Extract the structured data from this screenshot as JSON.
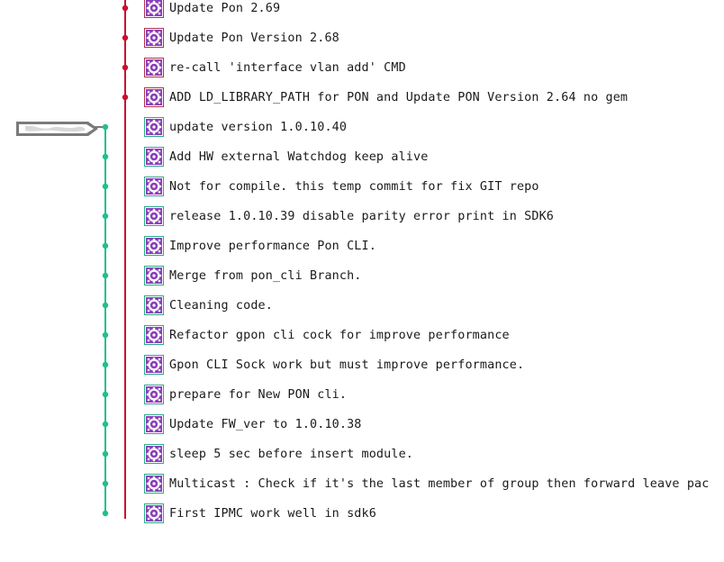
{
  "branches": {
    "main_color": "#c8102e",
    "feature_color": "#1fbf8f"
  },
  "commits": [
    {
      "message": "Update Pon 2.69",
      "branch": "main"
    },
    {
      "message": "Update Pon Version 2.68",
      "branch": "main"
    },
    {
      "message": "re-call 'interface vlan add' CMD",
      "branch": "main"
    },
    {
      "message": "ADD LD_LIBRARY_PATH for PON and Update PON Version 2.64 no gem",
      "branch": "main"
    },
    {
      "message": "update version 1.0.10.40",
      "branch": "feature"
    },
    {
      "message": "Add HW external Watchdog keep alive",
      "branch": "feature"
    },
    {
      "message": "Not for compile. this temp commit for fix GIT repo",
      "branch": "feature"
    },
    {
      "message": "release 1.0.10.39 disable parity error print in SDK6",
      "branch": "feature"
    },
    {
      "message": "Improve performance Pon CLI.",
      "branch": "feature"
    },
    {
      "message": "Merge from pon_cli Branch.",
      "branch": "feature"
    },
    {
      "message": "Cleaning code.",
      "branch": "feature"
    },
    {
      "message": "Refactor gpon cli cock for improve performance",
      "branch": "feature"
    },
    {
      "message": "Gpon CLI Sock work but must improve performance.",
      "branch": "feature"
    },
    {
      "message": "prepare for New PON cli.",
      "branch": "feature"
    },
    {
      "message": "Update FW_ver to 1.0.10.38",
      "branch": "feature"
    },
    {
      "message": "sleep 5 sec before insert module.",
      "branch": "feature"
    },
    {
      "message": "Multicast : Check if it's the last member of group then forward leave pac",
      "branch": "feature"
    },
    {
      "message": "First IPMC work well in sdk6",
      "branch": "feature"
    }
  ],
  "author_avatar_icon": "identicon-icon",
  "branch_tag_icon": "redacted-branch-tag-icon"
}
